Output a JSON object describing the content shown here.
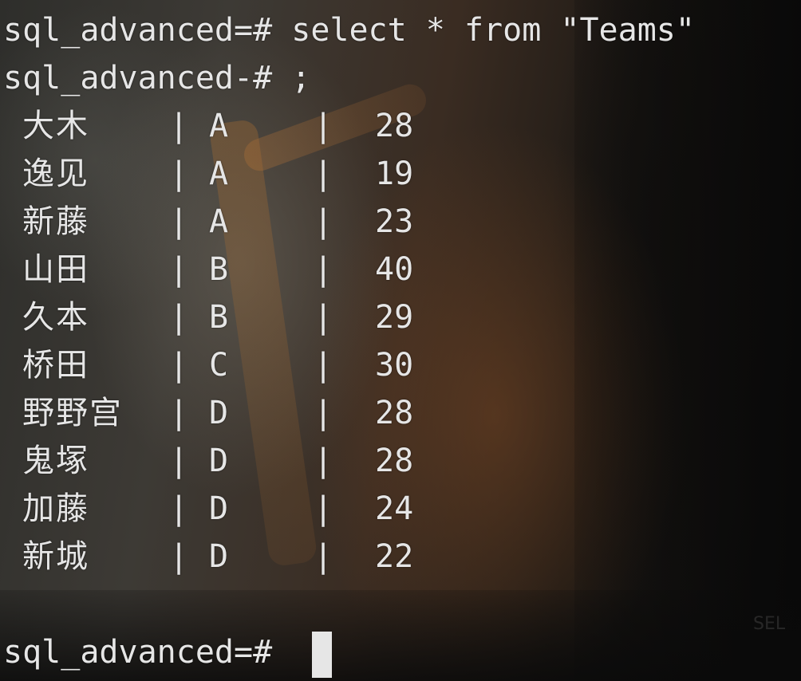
{
  "terminal": {
    "command_line_1": "sql_advanced=# select * from \"Teams\"",
    "command_line_2": "sql_advanced-# ;",
    "separator": "|",
    "rows": [
      {
        "name": "大木",
        "team": "A",
        "age": "28"
      },
      {
        "name": "逸见",
        "team": "A",
        "age": "19"
      },
      {
        "name": "新藤",
        "team": "A",
        "age": "23"
      },
      {
        "name": "山田",
        "team": "B",
        "age": "40"
      },
      {
        "name": "久本",
        "team": "B",
        "age": "29"
      },
      {
        "name": "桥田",
        "team": "C",
        "age": "30"
      },
      {
        "name": "野野宫",
        "team": "D",
        "age": "28"
      },
      {
        "name": "鬼塚",
        "team": "D",
        "age": "28"
      },
      {
        "name": "加藤",
        "team": "D",
        "age": "24"
      },
      {
        "name": "新城",
        "team": "D",
        "age": "22"
      }
    ],
    "prompt": "sql_advanced=# ",
    "background_watermark": "SEL"
  },
  "colors": {
    "text": "#e6e6e6",
    "cursor": "#e6e6e6",
    "background": "#121212"
  }
}
